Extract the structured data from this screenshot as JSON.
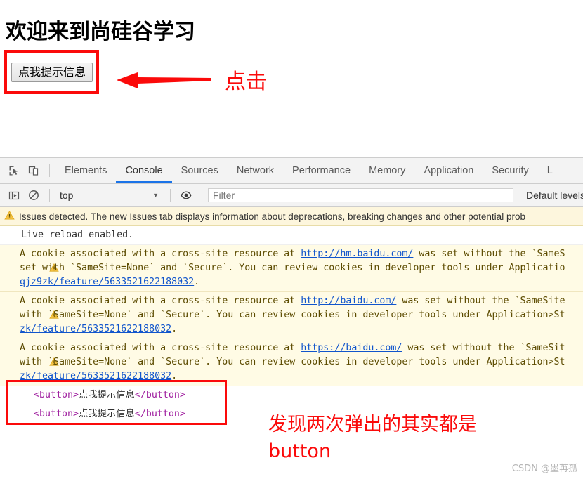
{
  "page": {
    "heading": "欢迎来到尚硅谷学习",
    "button_label": "点我提示信息",
    "arrow_annotation": "点击"
  },
  "devtools": {
    "tabs": [
      {
        "label": "Elements",
        "active": false
      },
      {
        "label": "Console",
        "active": true
      },
      {
        "label": "Sources",
        "active": false
      },
      {
        "label": "Network",
        "active": false
      },
      {
        "label": "Performance",
        "active": false
      },
      {
        "label": "Memory",
        "active": false
      },
      {
        "label": "Application",
        "active": false
      },
      {
        "label": "Security",
        "active": false
      },
      {
        "label": "L",
        "active": false
      }
    ],
    "icons": {
      "inspect": "inspect-element-icon",
      "device": "device-toolbar-icon",
      "sidebar": "console-sidebar-icon",
      "clear": "clear-console-icon",
      "eye": "live-expression-icon"
    },
    "console_toolbar": {
      "context": "top",
      "context_caret": "▼",
      "filter_placeholder": "Filter",
      "filter_value": "",
      "levels": "Default levels",
      "levels_caret": "▼"
    },
    "issues_bar": {
      "text": "Issues detected. The new Issues tab displays information about deprecations, breaking changes and other potential prob"
    },
    "messages": [
      {
        "type": "log",
        "text": "Live reload enabled."
      },
      {
        "type": "warn",
        "line1_a": "A cookie associated with a cross-site resource at ",
        "line1_link": "http://hm.baidu.com/",
        "line1_b": " was set without the `SameS",
        "line2": "set with `SameSite=None` and `Secure`. You can review cookies in developer tools under Applicatio",
        "line3_link": "qjz9zk/feature/5633521622188032",
        "line3_b": "."
      },
      {
        "type": "warn",
        "line1_a": "A cookie associated with a cross-site resource at ",
        "line1_link": "http://baidu.com/",
        "line1_b": " was set without the `SameSite",
        "line2": "with `SameSite=None` and `Secure`. You can review cookies in developer tools under Application>St",
        "line3_link": "zk/feature/5633521622188032",
        "line3_b": "."
      },
      {
        "type": "warn",
        "line1_a": "A cookie associated with a cross-site resource at ",
        "line1_link": "https://baidu.com/",
        "line1_b": " was set without the `SameSit",
        "line2": "with `SameSite=None` and `Secure`. You can review cookies in developer tools under Application>St",
        "line3_link": "zk/feature/5633521622188032",
        "line3_b": "."
      }
    ],
    "element_results": [
      {
        "open_tag": "<button>",
        "content": "点我提示信息",
        "close_tag": "</button>"
      },
      {
        "open_tag": "<button>",
        "content": "点我提示信息",
        "close_tag": "</button>"
      }
    ]
  },
  "annotations": {
    "bottom_text": "发现两次弹出的其实都是\nbutton",
    "watermark": "CSDN @墨苒孤"
  },
  "colors": {
    "annotation_red": "#fb0a0a",
    "active_tab_blue": "#1a73e8",
    "warning_bg": "#fffbe5",
    "warning_text": "#5c4b00",
    "link_blue": "#1155cc",
    "tag_purple": "#a020a0",
    "issues_bg": "#fdf6dd"
  }
}
